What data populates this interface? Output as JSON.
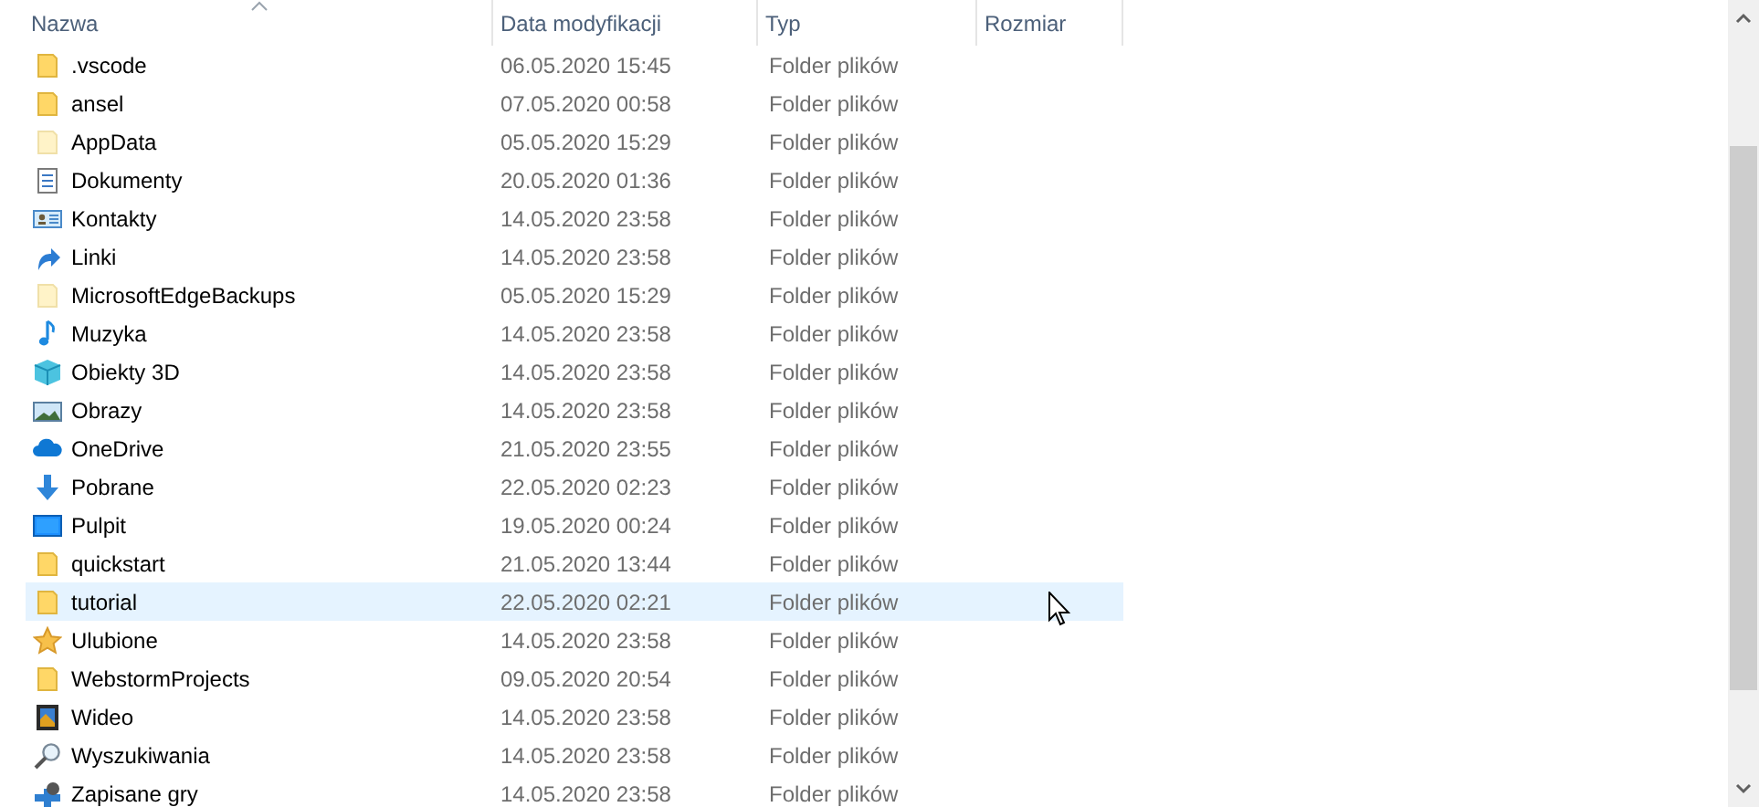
{
  "columns": [
    {
      "label": "Nazwa",
      "sorted": true
    },
    {
      "label": "Data modyfikacji",
      "sorted": false
    },
    {
      "label": "Typ",
      "sorted": false
    },
    {
      "label": "Rozmiar",
      "sorted": false
    }
  ],
  "rows": [
    {
      "kind": "folder",
      "name": ".vscode",
      "date": "06.05.2020 15:45",
      "type": "Folder plików",
      "hovered": false
    },
    {
      "kind": "folder",
      "name": "ansel",
      "date": "07.05.2020 00:58",
      "type": "Folder plików",
      "hovered": false
    },
    {
      "kind": "hidden",
      "name": "AppData",
      "date": "05.05.2020 15:29",
      "type": "Folder plików",
      "hovered": false
    },
    {
      "kind": "documents",
      "name": "Dokumenty",
      "date": "20.05.2020 01:36",
      "type": "Folder plików",
      "hovered": false
    },
    {
      "kind": "contacts",
      "name": "Kontakty",
      "date": "14.05.2020 23:58",
      "type": "Folder plików",
      "hovered": false
    },
    {
      "kind": "links",
      "name": "Linki",
      "date": "14.05.2020 23:58",
      "type": "Folder plików",
      "hovered": false
    },
    {
      "kind": "hidden",
      "name": "MicrosoftEdgeBackups",
      "date": "05.05.2020 15:29",
      "type": "Folder plików",
      "hovered": false
    },
    {
      "kind": "music",
      "name": "Muzyka",
      "date": "14.05.2020 23:58",
      "type": "Folder plików",
      "hovered": false
    },
    {
      "kind": "objects",
      "name": "Obiekty 3D",
      "date": "14.05.2020 23:58",
      "type": "Folder plików",
      "hovered": false
    },
    {
      "kind": "pictures",
      "name": "Obrazy",
      "date": "14.05.2020 23:58",
      "type": "Folder plików",
      "hovered": false
    },
    {
      "kind": "cloud",
      "name": "OneDrive",
      "date": "21.05.2020 23:55",
      "type": "Folder plików",
      "hovered": false
    },
    {
      "kind": "download",
      "name": "Pobrane",
      "date": "22.05.2020 02:23",
      "type": "Folder plików",
      "hovered": false
    },
    {
      "kind": "desktop",
      "name": "Pulpit",
      "date": "19.05.2020 00:24",
      "type": "Folder plików",
      "hovered": false
    },
    {
      "kind": "folder",
      "name": "quickstart",
      "date": "21.05.2020 13:44",
      "type": "Folder plików",
      "hovered": false
    },
    {
      "kind": "folder",
      "name": "tutorial",
      "date": "22.05.2020 02:21",
      "type": "Folder plików",
      "hovered": true
    },
    {
      "kind": "star",
      "name": "Ulubione",
      "date": "14.05.2020 23:58",
      "type": "Folder plików",
      "hovered": false
    },
    {
      "kind": "folder",
      "name": "WebstormProjects",
      "date": "09.05.2020 20:54",
      "type": "Folder plików",
      "hovered": false
    },
    {
      "kind": "video",
      "name": "Wideo",
      "date": "14.05.2020 23:58",
      "type": "Folder plików",
      "hovered": false
    },
    {
      "kind": "search",
      "name": "Wyszukiwania",
      "date": "14.05.2020 23:58",
      "type": "Folder plików",
      "hovered": false
    },
    {
      "kind": "games",
      "name": "Zapisane gry",
      "date": "14.05.2020 23:58",
      "type": "Folder plików",
      "hovered": false
    }
  ]
}
